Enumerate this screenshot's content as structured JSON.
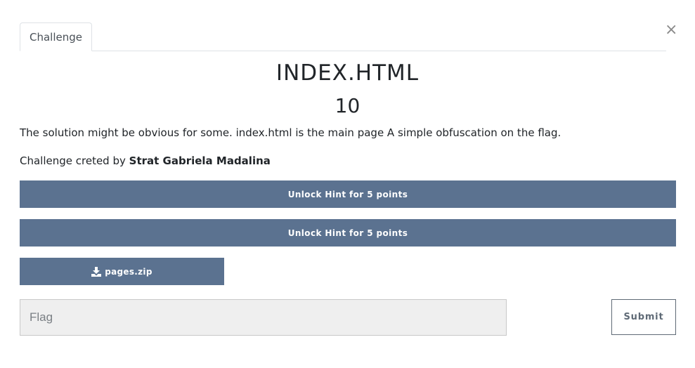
{
  "tabs": [
    {
      "label": "Challenge"
    }
  ],
  "close_glyph": "×",
  "challenge": {
    "name": "INDEX.HTML",
    "points": "10",
    "description": "The solution might be obvious for some. index.html is the main page A simple obfuscation on the flag.",
    "author_prefix": "Challenge creted by ",
    "author_name": "Strat Gabriela Madalina"
  },
  "hints": [
    {
      "label": "Unlock Hint for 5 points"
    },
    {
      "label": "Unlock Hint for 5 points"
    }
  ],
  "files": [
    {
      "name": "pages.zip",
      "icon": "download-icon"
    }
  ],
  "flag_form": {
    "placeholder": "Flag",
    "value": "",
    "submit_label": "Submit"
  },
  "colors": {
    "button_bg": "#5b7290",
    "input_bg": "#efefef",
    "submit_border": "#5f6a76"
  }
}
